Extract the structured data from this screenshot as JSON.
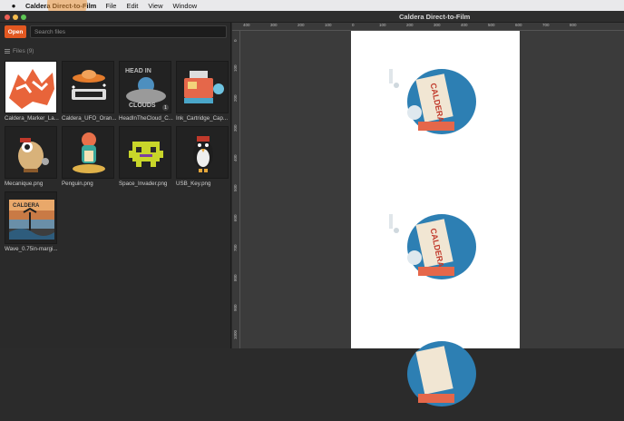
{
  "menubar": {
    "app_name": "Caldera Direct-to-Film",
    "items": [
      "File",
      "Edit",
      "View",
      "Window"
    ]
  },
  "window": {
    "title": "Caldera Direct-to-Film"
  },
  "toolbar": {
    "open_label": "Open",
    "search_placeholder": "Search files"
  },
  "files": {
    "header": "Files (9)",
    "items": [
      {
        "name": "Caldera_Marker_La...",
        "icon": "marker-graphic"
      },
      {
        "name": "Caldera_UFO_Oran...",
        "icon": "ufo-graphic"
      },
      {
        "name": "HeadInTheCloud_C...",
        "icon": "head-in-clouds-graphic",
        "badge": "1"
      },
      {
        "name": "Ink_Cartridge_Cap...",
        "icon": "ink-cartridge-graphic"
      },
      {
        "name": "Mecanique.png",
        "icon": "robot-bird-graphic"
      },
      {
        "name": "Penguin.png",
        "icon": "penguin-graphic"
      },
      {
        "name": "Space_Invader.png",
        "icon": "space-invader-graphic"
      },
      {
        "name": "USB_Key.png",
        "icon": "usb-key-penguin-graphic"
      },
      {
        "name": "Wave_0.75in-margi...",
        "icon": "wave-graphic"
      }
    ]
  },
  "ruler": {
    "top_labels": [
      "400",
      "300",
      "200",
      "100",
      "0",
      "100",
      "200",
      "300",
      "400",
      "500",
      "600",
      "700",
      "800"
    ],
    "left_labels": [
      "0",
      "100",
      "200",
      "300",
      "400",
      "500",
      "600",
      "700",
      "800",
      "900",
      "1000"
    ]
  },
  "colors": {
    "accent": "#e25821",
    "panel": "#2a2a2a",
    "canvas": "#3b3b3b",
    "film": "#ffffff"
  }
}
